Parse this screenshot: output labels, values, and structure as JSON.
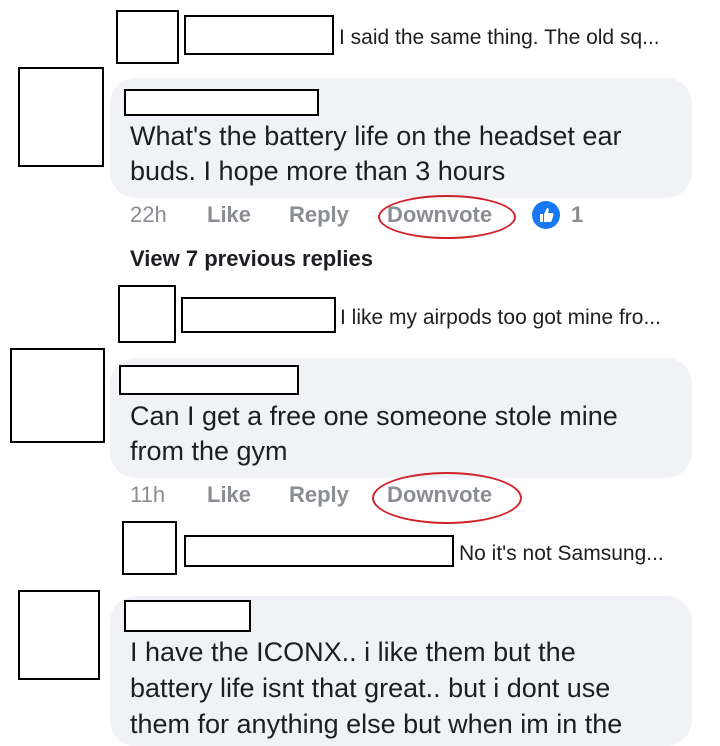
{
  "replies_preview": [
    {
      "text": "I said the same thing. The old sq..."
    },
    {
      "text": "I like my airpods too got mine fro..."
    },
    {
      "text": "No it's not Samsung..."
    }
  ],
  "comments": [
    {
      "lines": [
        "What's the battery life on the headset ear",
        "buds. I hope more than 3 hours"
      ],
      "time": "22h",
      "like_label": "Like",
      "reply_label": "Reply",
      "downvote_label": "Downvote",
      "reaction_count": "1",
      "reaction_icon": "thumbs-up-icon"
    },
    {
      "lines": [
        "Can I get a free one someone stole mine",
        "from the gym"
      ],
      "time": "11h",
      "like_label": "Like",
      "reply_label": "Reply",
      "downvote_label": "Downvote"
    },
    {
      "lines": [
        "I have the ICONX.. i like them but the",
        "battery life isnt that great.. but i dont use",
        "them for anything else but when im in the"
      ]
    }
  ],
  "view_previous_replies": "View 7 previous replies",
  "colors": {
    "bubble": "#f0f2f5",
    "meta_text": "#8a8d91",
    "annotation_red": "#d1232a",
    "reaction_blue": "#1877f2"
  }
}
